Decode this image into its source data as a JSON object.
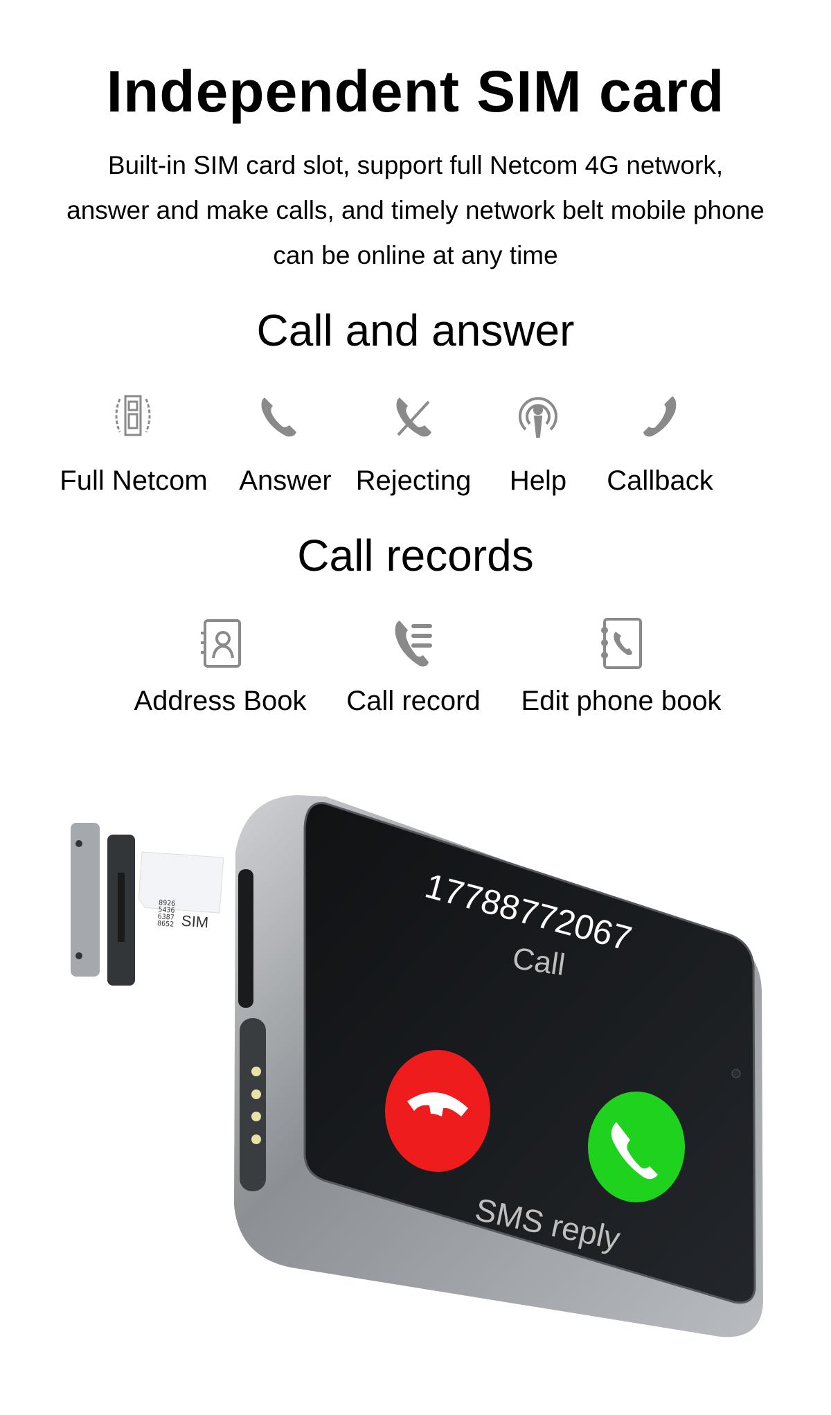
{
  "header": {
    "title": "Independent SIM card",
    "subtitle_lines": [
      "Built-in SIM card slot, support full Netcom 4G network,",
      "answer and make calls, and timely network belt mobile phone",
      "can be online at any time"
    ]
  },
  "call_answer": {
    "heading": "Call and answer",
    "items": [
      {
        "label": "Full Netcom",
        "icon": "sim-card-icon"
      },
      {
        "label": "Answer",
        "icon": "phone-icon"
      },
      {
        "label": "Rejecting",
        "icon": "phone-reject-icon"
      },
      {
        "label": "Help",
        "icon": "help-broadcast-icon"
      },
      {
        "label": "Callback",
        "icon": "callback-phone-icon"
      }
    ]
  },
  "call_records": {
    "heading": "Call records",
    "items": [
      {
        "label": "Address Book",
        "icon": "address-book-icon"
      },
      {
        "label": "Call record",
        "icon": "call-list-icon"
      },
      {
        "label": "Edit phone book",
        "icon": "phone-book-icon"
      }
    ]
  },
  "device": {
    "sim_card_numbers": [
      "8926",
      "5436",
      "6387",
      "8652"
    ],
    "sim_card_label": "SIM",
    "caller_number": "17788772067",
    "call_status": "Call",
    "sms_reply": "SMS reply",
    "colors": {
      "decline": "#ee1c1c",
      "accept": "#1ed21e",
      "icon_gray": "#8a8a8a",
      "screen": "#17191b"
    }
  }
}
